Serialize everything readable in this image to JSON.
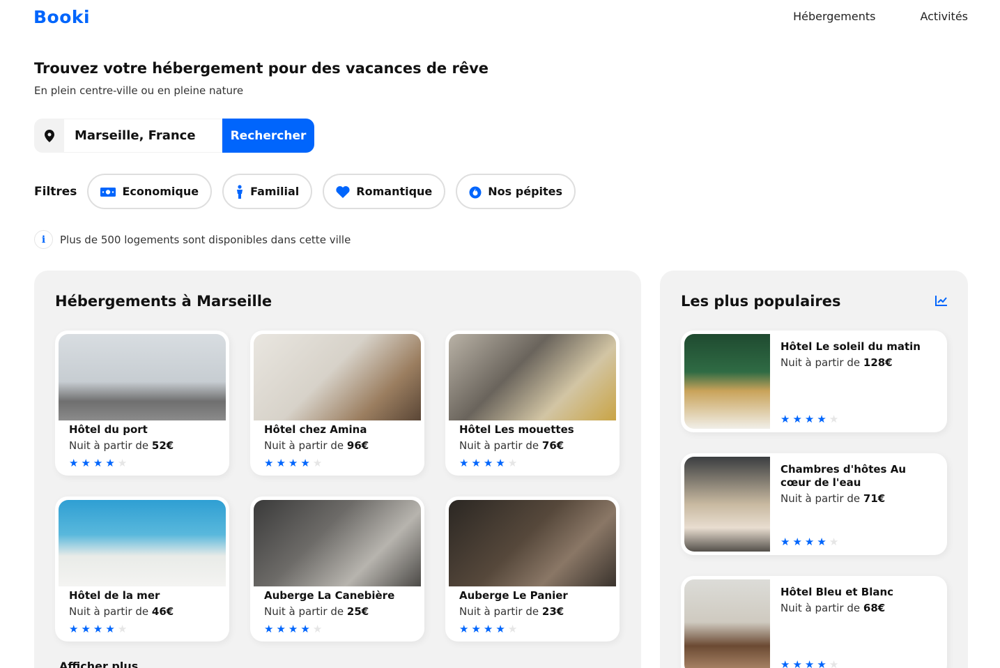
{
  "header": {
    "logo": "Booki",
    "nav": [
      "Hébergements",
      "Activités"
    ]
  },
  "hero": {
    "title": "Trouvez votre hébergement pour des vacances de rêve",
    "subtitle": "En plein centre-ville ou en pleine nature"
  },
  "search": {
    "value": "Marseille, France",
    "button": "Rechercher",
    "icon": "location-pin-icon"
  },
  "filters": {
    "label": "Filtres",
    "items": [
      {
        "label": "Economique",
        "icon": "money-icon"
      },
      {
        "label": "Familial",
        "icon": "person-icon"
      },
      {
        "label": "Romantique",
        "icon": "heart-icon"
      },
      {
        "label": "Nos pépites",
        "icon": "fire-icon"
      }
    ]
  },
  "info": {
    "icon": "i",
    "text": "Plus de 500 logements sont disponibles dans cette ville"
  },
  "accommodations": {
    "title": "Hébergements à Marseille",
    "price_prefix": "Nuit à partir de",
    "items": [
      {
        "name": "Hôtel du port",
        "price": "52€",
        "rating": 4
      },
      {
        "name": "Hôtel chez Amina",
        "price": "96€",
        "rating": 4
      },
      {
        "name": "Hôtel Les mouettes",
        "price": "76€",
        "rating": 4
      },
      {
        "name": "Hôtel de la mer",
        "price": "46€",
        "rating": 4
      },
      {
        "name": "Auberge La Canebière",
        "price": "25€",
        "rating": 4
      },
      {
        "name": "Auberge Le Panier",
        "price": "23€",
        "rating": 4
      }
    ],
    "more": "Afficher plus"
  },
  "popular": {
    "title": "Les plus populaires",
    "icon": "trending-chart-icon",
    "price_prefix": "Nuit à partir de",
    "items": [
      {
        "name": "Hôtel Le soleil du matin",
        "price": "128€",
        "rating": 4
      },
      {
        "name": "Chambres d'hôtes Au cœur de l'eau",
        "price": "71€",
        "rating": 4
      },
      {
        "name": "Hôtel Bleu et Blanc",
        "price": "68€",
        "rating": 4
      }
    ]
  },
  "colors": {
    "accent": "#0065fc",
    "panel": "#f2f2f2"
  }
}
